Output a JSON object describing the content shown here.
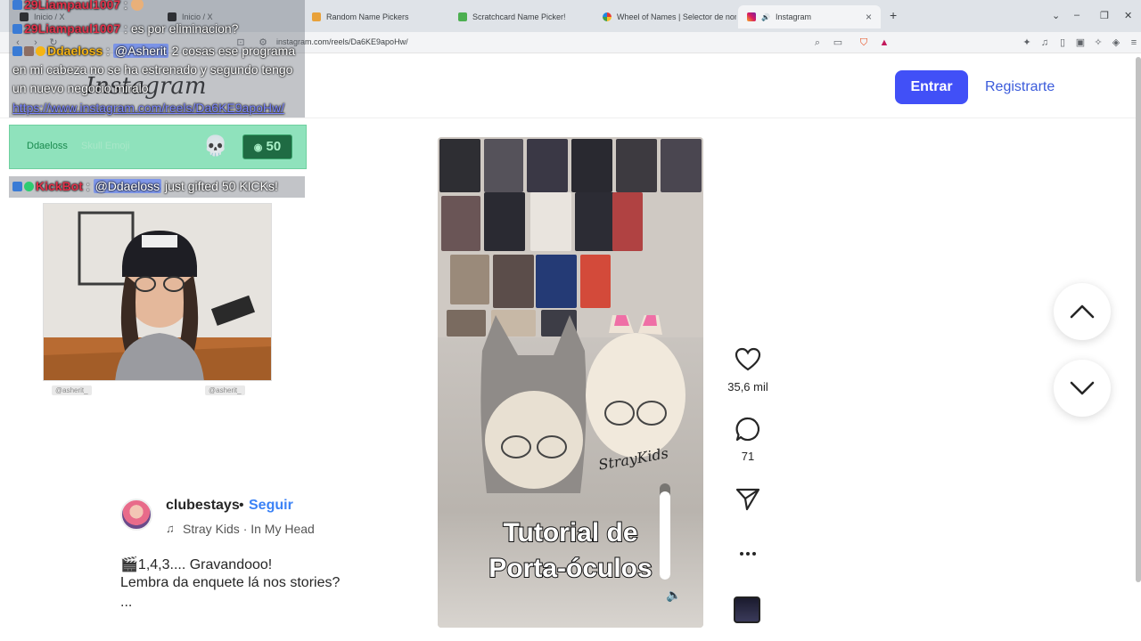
{
  "browser": {
    "tabs": [
      {
        "label": "Inicio / X",
        "active": false
      },
      {
        "label": "Inicio / X",
        "active": false
      },
      {
        "label": "Random Name Pickers",
        "active": false
      },
      {
        "label": "Scratchcard Name Picker!",
        "active": false
      },
      {
        "label": "Wheel of Names | Selector de nomb",
        "active": false
      },
      {
        "label": "Instagram",
        "active": true
      }
    ],
    "url": "instagram.com/reels/Da6KE9apoHw/"
  },
  "header": {
    "logo": "Instagram",
    "login_label": "Entrar",
    "signup_label": "Registrarte"
  },
  "reel": {
    "title_line1": "Tutorial de",
    "title_line2": "Porta-óculos",
    "watermark": "StrayKids",
    "volume_level": 0.92,
    "likes": "35,6 mil",
    "comments": "71"
  },
  "author": {
    "username": "clubestays",
    "separator": "•",
    "follow_label": "Seguir",
    "music": "Stray Kids · In My Head"
  },
  "caption": {
    "line1": "🎬1,4,3.... Gravandooo!",
    "line2": "Lembra da enquete lá nos stories?",
    "more": "..."
  },
  "overlay": {
    "chat": [
      {
        "user": "29Liampaul1007",
        "text": " : "
      },
      {
        "user": "29Liampaul1007",
        "text": " : es por eliminacion?"
      },
      {
        "user": "Ddaeloss",
        "mention": "@Asherit",
        "text": " 2 cosas ese programa en mi cabeza no se ha estrenado y segundo tengo un nuevo negocio miralo"
      },
      {
        "link": "https://www.instagram.com/reels/Da6KE9apoHw/"
      }
    ],
    "gift": {
      "user": "Ddaeloss",
      "item": "Skull Emoji",
      "amount": "50"
    },
    "kickbot": {
      "user": "KickBot",
      "mention": "@Ddaeloss",
      "text": " just gifted 50 KICKs!"
    },
    "socials": [
      "@asherit_",
      "@asherit_"
    ]
  },
  "colors": {
    "primary_button": "#4150f7",
    "link": "#3b82f6",
    "chat_username_red": "#e0324a",
    "chat_username_yellow": "#f5b414",
    "gift_banner": "#8fe2bc"
  }
}
